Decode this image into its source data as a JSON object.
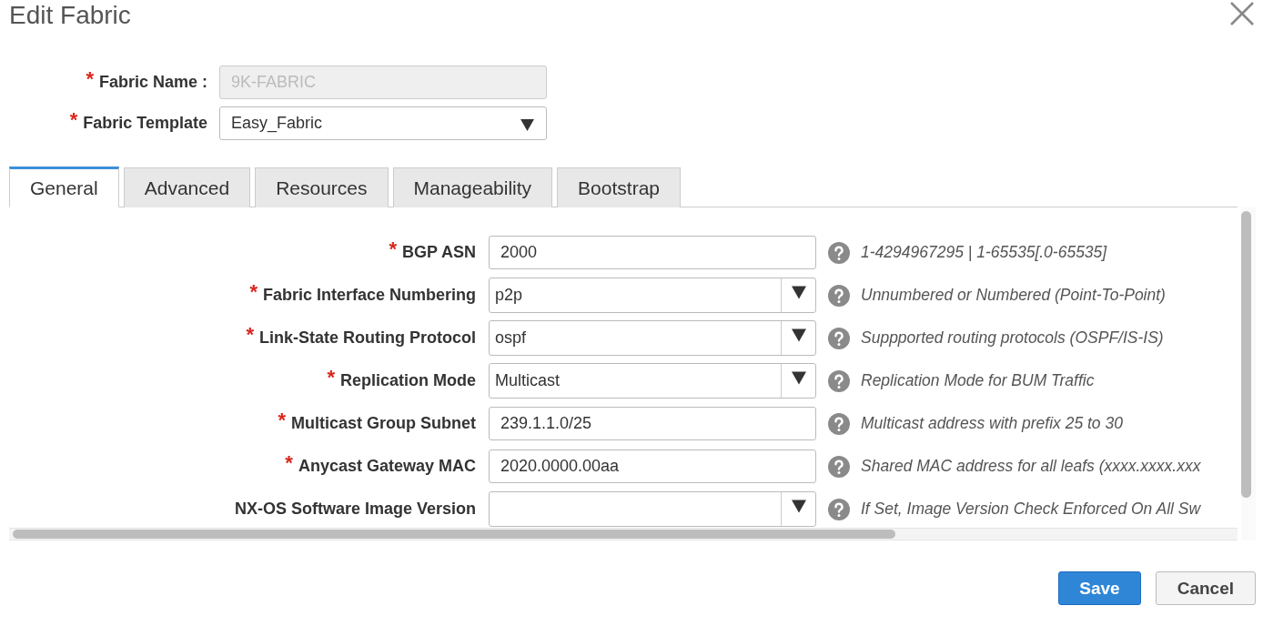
{
  "window": {
    "title": "Edit Fabric"
  },
  "header_fields": [
    {
      "marker": "*",
      "label": "Fabric Name :",
      "kind": "text",
      "disabled": true,
      "value": "9K-FABRIC"
    },
    {
      "marker": "*",
      "label": "Fabric Template",
      "kind": "select",
      "disabled": false,
      "value": "Easy_Fabric"
    }
  ],
  "tabs": [
    {
      "label": "General",
      "selected": true
    },
    {
      "label": "Advanced",
      "selected": false
    },
    {
      "label": "Resources",
      "selected": false
    },
    {
      "label": "Manageability",
      "selected": false
    },
    {
      "label": "Bootstrap",
      "selected": false
    }
  ],
  "fields": [
    {
      "marker": "*",
      "label": "BGP ASN",
      "kind": "text",
      "value": "2000",
      "help": "1-4294967295 | 1-65535[.0-65535]"
    },
    {
      "marker": "*",
      "label": "Fabric Interface Numbering",
      "kind": "select",
      "value": "p2p",
      "help": "Unnumbered or Numbered (Point-To-Point)"
    },
    {
      "marker": "*",
      "label": "Link-State Routing Protocol",
      "kind": "select",
      "value": "ospf",
      "help": "Suppported routing protocols (OSPF/IS-IS)"
    },
    {
      "marker": "*",
      "label": "Replication Mode",
      "kind": "select",
      "value": "Multicast",
      "help": "Replication Mode for BUM Traffic"
    },
    {
      "marker": "*",
      "label": "Multicast Group Subnet",
      "kind": "text",
      "value": "239.1.1.0/25",
      "help": "Multicast address with prefix 25 to 30"
    },
    {
      "marker": "*",
      "label": "Anycast Gateway MAC",
      "kind": "text",
      "value": "2020.0000.00aa",
      "help": "Shared MAC address for all leafs (xxxx.xxxx.xxx"
    },
    {
      "label": "NX-OS Software Image Version",
      "kind": "select",
      "help": "If Set, Image Version Check Enforced On All Sw"
    }
  ],
  "buttons": [
    {
      "label": "Save",
      "kind": "primary"
    },
    {
      "label": "Cancel",
      "kind": "secondary"
    }
  ]
}
